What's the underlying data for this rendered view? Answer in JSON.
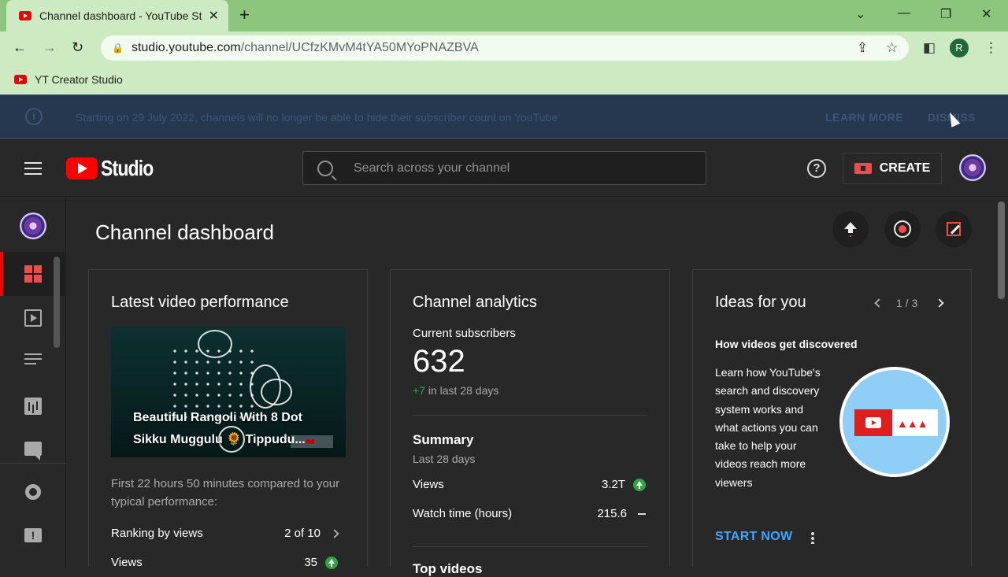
{
  "browser": {
    "tab_title": "Channel dashboard - YouTube Studio",
    "url_host": "studio.youtube.com",
    "url_path": "/channel/UCfzKMvM4tYA50MYoPNAZBVA",
    "profile_initial": "R",
    "bookmark": "YT Creator Studio"
  },
  "banner": {
    "message": "Starting on 29 July 2022, channels will no longer be able to hide their subscriber count on YouTube",
    "learn_more": "LEARN MORE",
    "dismiss": "DISMISS"
  },
  "header": {
    "logo_text": "Studio",
    "search_placeholder": "Search across your channel",
    "create_label": "CREATE"
  },
  "page": {
    "title": "Channel dashboard"
  },
  "latest_video": {
    "title": "Latest video performance",
    "video_title": "Beautiful Rangoli With 8 Dot Sikku Muggulu 🌻 Tippudu...",
    "compare_text": "First 22 hours 50 minutes compared to your typical performance:",
    "ranking_label": "Ranking by views",
    "ranking_value": "2 of 10",
    "views_label": "Views",
    "views_value": "35"
  },
  "analytics": {
    "title": "Channel analytics",
    "subs_label": "Current subscribers",
    "subs_count": "632",
    "subs_delta": "+7",
    "subs_delta_suffix": " in last 28 days",
    "summary_title": "Summary",
    "summary_sub": "Last 28 days",
    "views_label": "Views",
    "views_value": "3.2T",
    "watch_label": "Watch time (hours)",
    "watch_value": "215.6",
    "next_section": "Top videos"
  },
  "ideas": {
    "title": "Ideas for you",
    "pager": "1 / 3",
    "idea_title": "How videos get discovered",
    "idea_body": "Learn how YouTube's search and discovery system works and what actions you can take to help your videos reach more viewers",
    "cta": "START NOW"
  },
  "colors": {
    "brand_red": "#ff0000",
    "link_blue": "#3ea6ff",
    "positive_green": "#2ba640",
    "studio_bg": "#282828"
  }
}
